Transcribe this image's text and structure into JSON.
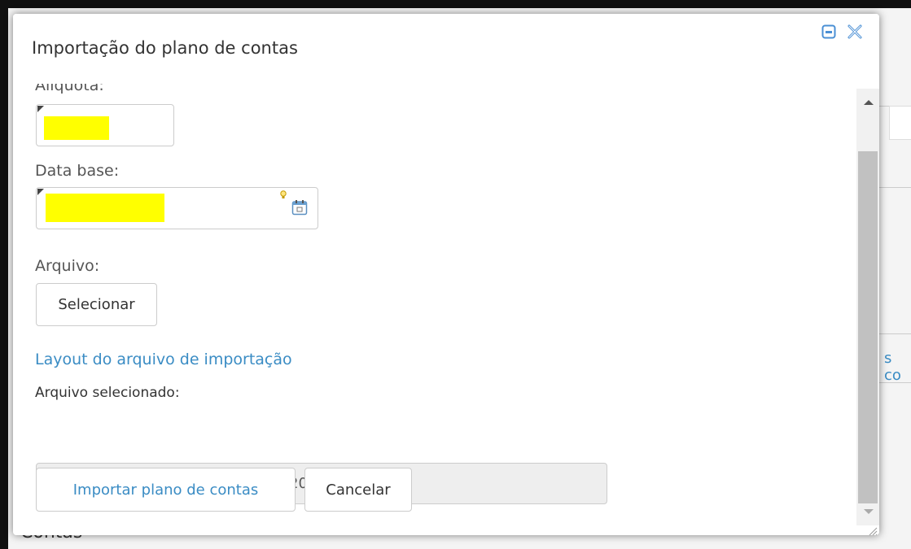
{
  "modal": {
    "title": "Importação do plano de contas"
  },
  "fields": {
    "aliquota_label": "Alíquota:",
    "data_base_label": "Data base:",
    "arquivo_label": "Arquivo:",
    "select_button": "Selecionar",
    "layout_link": "Layout do arquivo de importação",
    "selected_file_label": "Arquivo selecionado:",
    "selected_file_value": "2478_LivroEletronico_PGC_02-2020.txt"
  },
  "actions": {
    "import_button": "Importar plano de contas",
    "cancel_button": "Cancelar"
  },
  "background": {
    "bottom_text": "Contas",
    "right_text": "s co"
  },
  "icons": {
    "minimize": "window-minimize-icon",
    "close": "close-icon",
    "calendar": "calendar-icon",
    "hint": "lightbulb-icon"
  },
  "colors": {
    "link": "#3a8cc4",
    "redaction": "#ffff00",
    "header_icons": "#4a8fd4"
  }
}
